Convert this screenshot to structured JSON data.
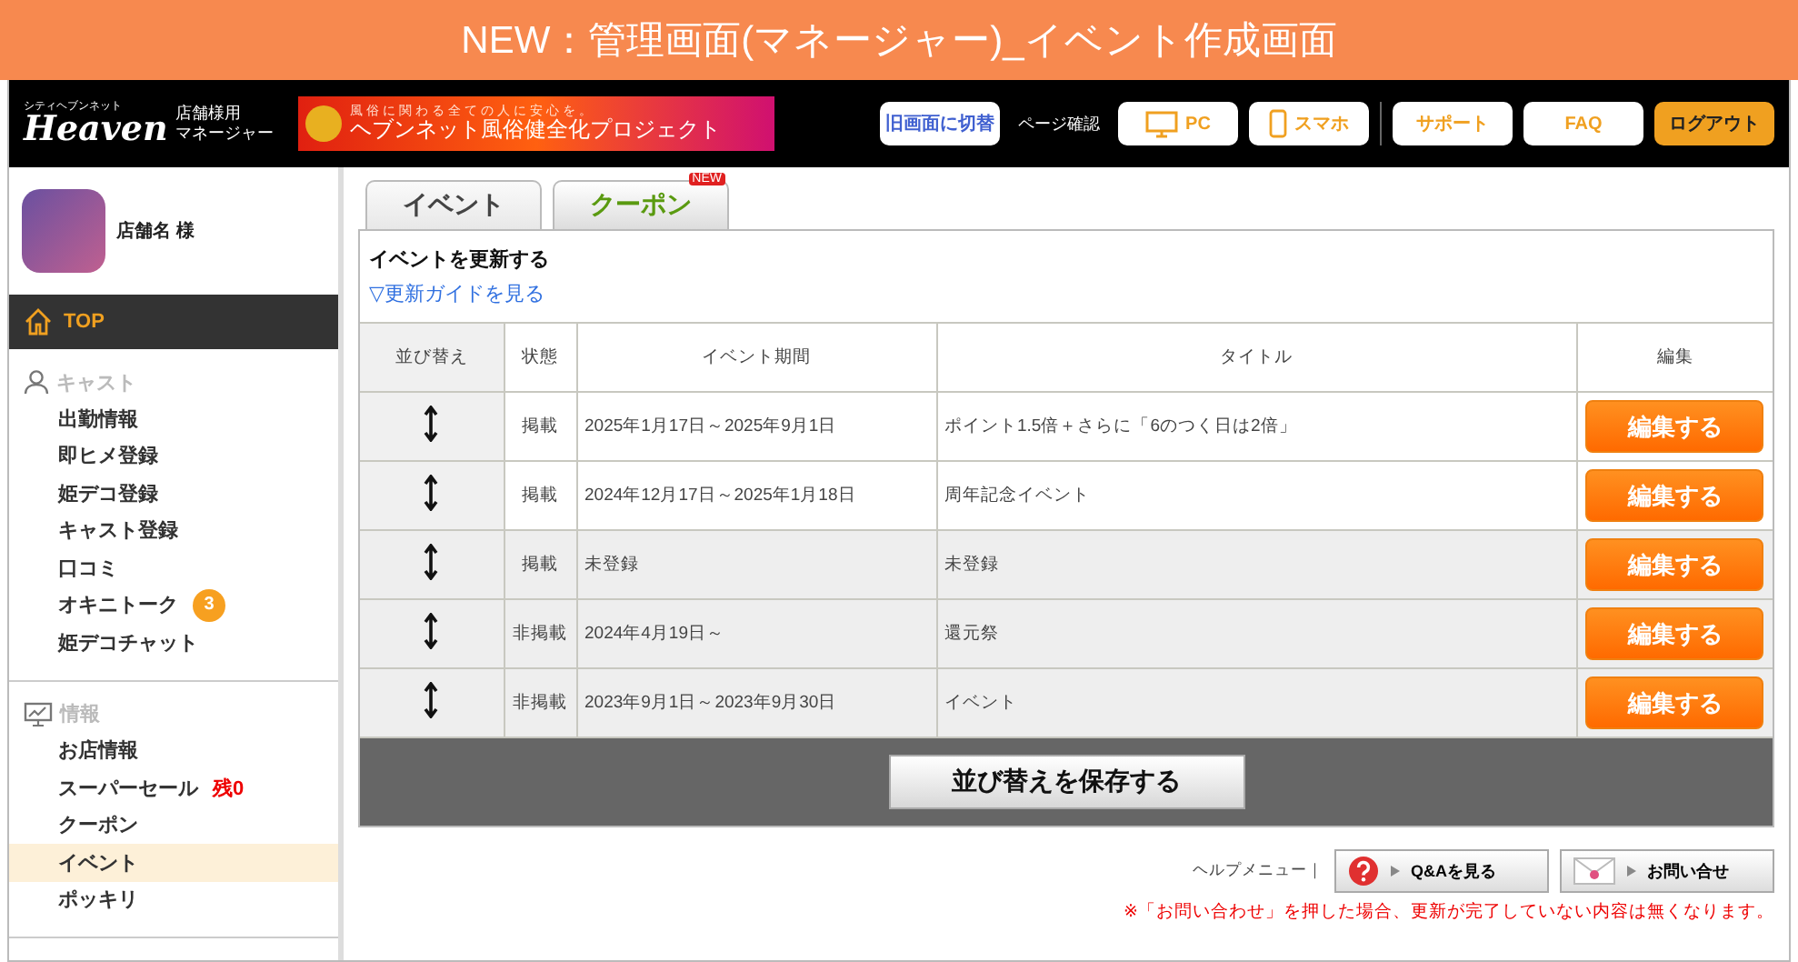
{
  "page_title": "NEW：管理画面(マネージャー)_イベント作成画面",
  "header": {
    "logo_top": "シティヘブンネット",
    "logo": "Heaven",
    "logo_sub": [
      "店舗様用",
      "マネージャー"
    ],
    "banner_top": "風俗に関わる全ての人に安心を。",
    "banner_main": "ヘブンネット風俗健全化プロジェクト",
    "switch_button": "旧画面に切替",
    "page_check_label": "ページ確認",
    "buttons": [
      {
        "label": "PC",
        "kind": "pc"
      },
      {
        "label": "スマホ",
        "kind": "phone"
      },
      {
        "label": "サポート",
        "kind": "plain"
      },
      {
        "label": "FAQ",
        "kind": "plain"
      },
      {
        "label": "ログアウト",
        "kind": "primary"
      }
    ]
  },
  "sidebar": {
    "shop_name": "店舗名 様",
    "top": {
      "label": "TOP",
      "selected": true
    },
    "sections": [
      {
        "title": "キャスト",
        "items": [
          {
            "label": "出勤情報",
            "selected": false
          },
          {
            "label": "即ヒメ登録",
            "selected": false
          },
          {
            "label": "姫デコ登録",
            "selected": false
          },
          {
            "label": "キャスト登録",
            "selected": false
          },
          {
            "label": "口コミ",
            "selected": false
          },
          {
            "label": "オキニトーク",
            "selected": false,
            "badge": "3"
          },
          {
            "label": "姫デコチャット",
            "selected": false
          }
        ]
      },
      {
        "title": "情報",
        "items": [
          {
            "label": "お店情報",
            "selected": false
          },
          {
            "label": "スーパーセール",
            "selected": false,
            "note": "残0"
          },
          {
            "label": "クーポン",
            "selected": false
          },
          {
            "label": "イベント",
            "selected": true
          },
          {
            "label": "ポッキリ",
            "selected": false
          }
        ]
      }
    ]
  },
  "tabs": [
    {
      "label": "イベント",
      "selected": true
    },
    {
      "label": "クーポン",
      "selected": false,
      "badge": "NEW"
    }
  ],
  "panel": {
    "heading": "イベントを更新する",
    "guide_link": "▽更新ガイドを見る",
    "table": {
      "columns": [
        "並び替え",
        "状態",
        "イベント期間",
        "タイトル",
        "編集"
      ],
      "rows": [
        {
          "status": "掲載",
          "period": "2025年1月17日～2025年9月1日",
          "title": "ポイント1.5倍＋さらに「6のつく日は2倍」",
          "edit": "編集する",
          "dimmed": false
        },
        {
          "status": "掲載",
          "period": "2024年12月17日～2025年1月18日",
          "title": "周年記念イベント",
          "edit": "編集する",
          "dimmed": false
        },
        {
          "status": "掲載",
          "period": "未登録",
          "title": "未登録",
          "edit": "編集する",
          "dimmed": true
        },
        {
          "status": "非掲載",
          "period": "2024年4月19日～",
          "title": "還元祭",
          "edit": "編集する",
          "dimmed": true
        },
        {
          "status": "非掲載",
          "period": "2023年9月1日～2023年9月30日",
          "title": "イベント",
          "edit": "編集する",
          "dimmed": true
        }
      ]
    },
    "save_button": "並び替えを保存する"
  },
  "help": {
    "label": "ヘルプメニュー｜",
    "buttons": [
      {
        "label": "Q&Aを見る",
        "kind": "question"
      },
      {
        "label": "お問い合せ",
        "kind": "mail"
      }
    ],
    "warning": "※「お問い合わせ」を押した場合、更新が完了していない内容は無くなります。"
  }
}
